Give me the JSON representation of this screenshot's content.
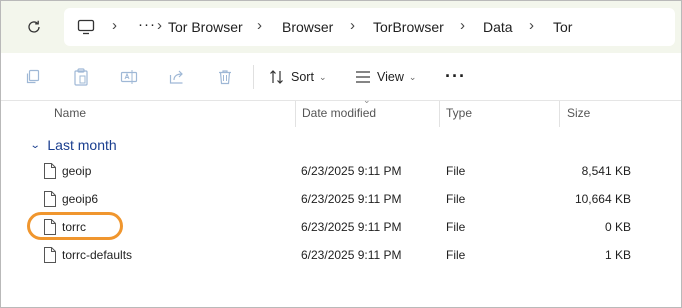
{
  "address": {
    "crumbs": [
      "Tor Browser",
      "Browser",
      "TorBrowser",
      "Data",
      "Tor"
    ],
    "overflow": "···",
    "separator": "›"
  },
  "toolbar": {
    "sort_label": "Sort",
    "view_label": "View",
    "more_label": "···"
  },
  "columns": {
    "name": "Name",
    "date": "Date modified",
    "type": "Type",
    "size": "Size"
  },
  "group": {
    "label": "Last month"
  },
  "files": [
    {
      "name": "geoip",
      "date": "6/23/2025 9:11 PM",
      "type": "File",
      "size": "8,541 KB"
    },
    {
      "name": "geoip6",
      "date": "6/23/2025 9:11 PM",
      "type": "File",
      "size": "10,664 KB"
    },
    {
      "name": "torrc",
      "date": "6/23/2025 9:11 PM",
      "type": "File",
      "size": "0 KB"
    },
    {
      "name": "torrc-defaults",
      "date": "6/23/2025 9:11 PM",
      "type": "File",
      "size": "1 KB"
    }
  ],
  "colors": {
    "accent_highlight": "#f0962e",
    "group_text": "#1a3e8f",
    "address_bg": "#f3f6ec"
  },
  "icons": [
    "refresh-icon",
    "computer-icon",
    "copy-icon",
    "paste-icon",
    "rename-icon",
    "share-icon",
    "delete-icon",
    "sort-icon",
    "view-icon",
    "file-icon"
  ]
}
